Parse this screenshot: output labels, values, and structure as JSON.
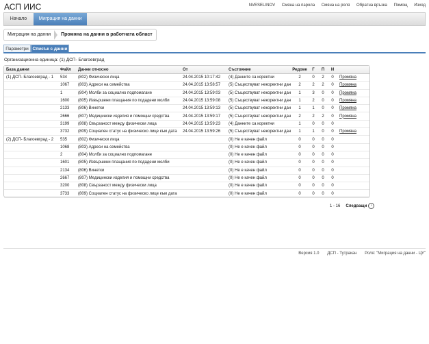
{
  "app": {
    "title": "АСП ИИС"
  },
  "top_links": {
    "user": "NVESELINOV",
    "change_password": "Смяна на парола",
    "change_role": "Смяна на роля",
    "feedback": "Обратна връзка",
    "help": "Помощ",
    "logout": "Изход"
  },
  "nav": {
    "home": "Начало",
    "active": "Миграция на данни"
  },
  "breadcrumb": {
    "parent": "Миграция на данни",
    "current": "Промяна на данни в работната област"
  },
  "subtabs": {
    "params": "Параметри",
    "list": "Списък с данни"
  },
  "org_unit": "Организационна единица: (1) ДСП- Благоевград",
  "table": {
    "headers": [
      "База данни",
      "Файл",
      "Данни относно",
      "От",
      "Състояние",
      "Редове",
      "Г",
      "П",
      "И",
      ""
    ],
    "rows": [
      [
        "(1) ДСП- Благоевград - 1",
        "534",
        "(802) Физически лица",
        "24.04.2015 10:17:42",
        "(4) Данните са коректни",
        "2",
        "0",
        "2",
        "0",
        "Промяна"
      ],
      [
        "",
        "1067",
        "(803) Адреси на семейства",
        "24.04.2015 13:58:57",
        "(5) Съществуват некоректни данни",
        "2",
        "2",
        "2",
        "0",
        "Промяна"
      ],
      [
        "",
        "1",
        "(804) Молби за социално подпомагане",
        "24.04.2015 13:59:03",
        "(5) Съществуват некоректни данни",
        "1",
        "3",
        "0",
        "0",
        "Промяна"
      ],
      [
        "",
        "1600",
        "(805) Извършени плащания по подадени молби",
        "24.04.2015 13:59:08",
        "(5) Съществуват некоректни данни",
        "1",
        "2",
        "0",
        "0",
        "Промяна"
      ],
      [
        "",
        "2133",
        "(806) Винетки",
        "24.04.2015 13:59:13",
        "(5) Съществуват некоректни данни",
        "1",
        "1",
        "0",
        "0",
        "Промяна"
      ],
      [
        "",
        "2666",
        "(807) Медицински изделия и помощни средства",
        "24.04.2015 13:59:17",
        "(5) Съществуват некоректни данни",
        "2",
        "2",
        "2",
        "0",
        "Промяна"
      ],
      [
        "",
        "3199",
        "(808) Свързаност между физически лица",
        "24.04.2015 13:59:23",
        "(4) Данните са коректни",
        "1",
        "0",
        "0",
        "0",
        ""
      ],
      [
        "",
        "3732",
        "(809) Социален статус на физическо лице към дата",
        "24.04.2015 13:59:26",
        "(5) Съществуват некоректни данни",
        "1",
        "1",
        "0",
        "0",
        "Промяна"
      ],
      [
        "(2) ДСП- Благоевград - 2",
        "535",
        "(802) Физически лица",
        "",
        "(0) Не е качен файл",
        "0",
        "0",
        "0",
        "0",
        ""
      ],
      [
        "",
        "1068",
        "(803) Адреси на семейства",
        "",
        "(0) Не е качен файл",
        "0",
        "0",
        "0",
        "0",
        ""
      ],
      [
        "",
        "2",
        "(804) Молби за социално подпомагане",
        "",
        "(0) Не е качен файл",
        "0",
        "0",
        "0",
        "0",
        ""
      ],
      [
        "",
        "1601",
        "(805) Извършени плащания по подадени молби",
        "",
        "(0) Не е качен файл",
        "0",
        "0",
        "0",
        "0",
        ""
      ],
      [
        "",
        "2134",
        "(806) Винетки",
        "",
        "(0) Не е качен файл",
        "0",
        "0",
        "0",
        "0",
        ""
      ],
      [
        "",
        "2667",
        "(807) Медицински изделия и помощни средства",
        "",
        "(0) Не е качен файл",
        "0",
        "0",
        "0",
        "0",
        ""
      ],
      [
        "",
        "3200",
        "(808) Свързаност между физически лица",
        "",
        "(0) Не е качен файл",
        "0",
        "0",
        "0",
        "0",
        ""
      ],
      [
        "",
        "3733",
        "(809) Социален статус на физическо лице към дата",
        "",
        "(0) Не е качен файл",
        "0",
        "0",
        "0",
        "0",
        ""
      ]
    ]
  },
  "pager": {
    "range": "1 - 16",
    "next": "Следващи"
  },
  "footer": {
    "version": "Версия 1.0",
    "unit": "ДСП - Тутракан",
    "role": "Роля: \"Миграция на данни - ЦУ\""
  }
}
